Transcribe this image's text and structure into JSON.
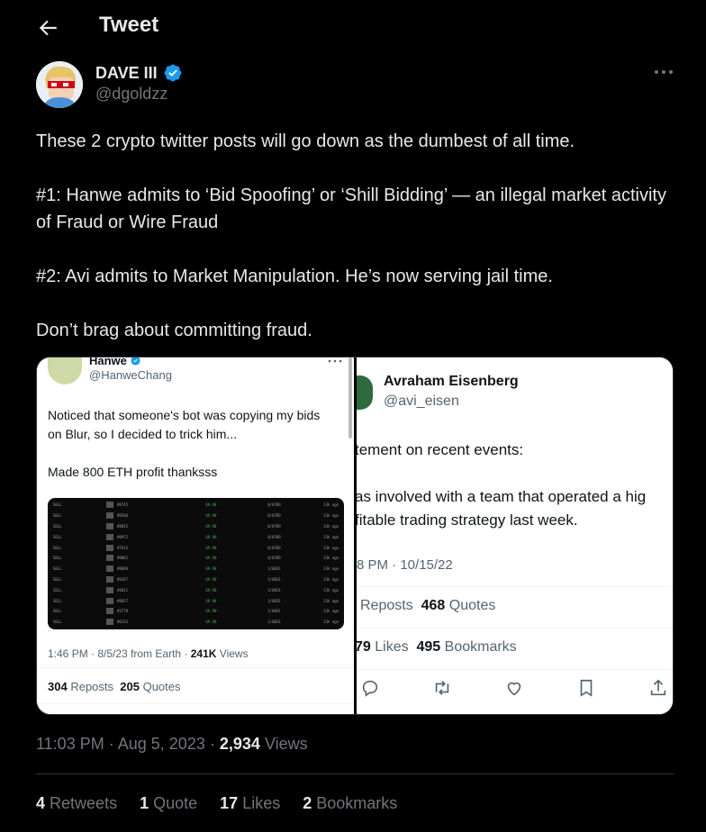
{
  "header": {
    "title": "Tweet"
  },
  "author": {
    "name": "DAVE III",
    "handle": "@dgoldzz"
  },
  "tweet": {
    "paragraphs": [
      "These 2 crypto twitter posts will go down as the dumbest of all time.",
      "#1: Hanwe admits to ‘Bid Spoofing’ or ‘Shill Bidding’ — an illegal market activity of Fraud or Wire Fraud",
      "#2: Avi admits to Market Manipulation. He’s now serving jail time.",
      "Don’t brag about committing fraud."
    ],
    "time": "11:03 PM",
    "date": "Aug 5, 2023",
    "views_count": "2,934",
    "views_label": "Views",
    "separator": "·"
  },
  "stats": {
    "retweets_count": "4",
    "retweets_label": "Retweets",
    "quotes_count": "1",
    "quotes_label": "Quote",
    "likes_count": "17",
    "likes_label": "Likes",
    "bookmarks_count": "2",
    "bookmarks_label": "Bookmarks"
  },
  "embed_left": {
    "name": "Hanwe",
    "handle": "@HanweChang",
    "text1": "Noticed that someone's bot was copying my bids on Blur, so I decided to trick him...",
    "text2": "Made 800 ETH profit thanksss",
    "meta_time": "1:46 PM · 8/5/23 from Earth ·",
    "views_count": "241K",
    "views_label": "Views",
    "reposts_count": "304",
    "reposts_label": "Reposts",
    "quotes_count": "205",
    "quotes_label": "Quotes",
    "table_rows": [
      [
        "SELL",
        "#8745",
        "69.90",
        "0/0789",
        "13h ago"
      ],
      [
        "SELL",
        "#8560",
        "69.90",
        "0/0789",
        "13h ago"
      ],
      [
        "SELL",
        "#8835",
        "69.90",
        "0/0789",
        "13h ago"
      ],
      [
        "SELL",
        "#8972",
        "69.90",
        "0/0789",
        "13h ago"
      ],
      [
        "SELL",
        "#7613",
        "69.90",
        "0/0789",
        "13h ago"
      ],
      [
        "SELL",
        "#8081",
        "69.90",
        "0/0789",
        "13h ago"
      ],
      [
        "SELL",
        "#8096",
        "69.90",
        "1/0831",
        "13h ago"
      ],
      [
        "SELL",
        "#8167",
        "69.90",
        "1/0831",
        "13h ago"
      ],
      [
        "SELL",
        "#4821",
        "69.90",
        "1/0831",
        "13h ago"
      ],
      [
        "SELL",
        "#8027",
        "69.90",
        "1/0831",
        "13h ago"
      ],
      [
        "SELL",
        "#2778",
        "69.90",
        "1/0831",
        "13h ago"
      ],
      [
        "SELL",
        "#8313",
        "69.90",
        "1/0831",
        "13h ago"
      ]
    ]
  },
  "embed_right": {
    "name": "Avraham Eisenberg",
    "handle": "@avi_eisen",
    "line1": "tement on recent events:",
    "line2": "as involved with a team that operated a hig",
    "line3": "fitable trading strategy last week.",
    "date": "8 PM · 10/15/22",
    "reposts_label": "Reposts",
    "quotes_count": "468",
    "quotes_label": "Quotes",
    "likes_count": "79",
    "likes_label": "Likes",
    "bookmarks_count": "495",
    "bookmarks_label": "Bookmarks"
  },
  "colors": {
    "verified": "#1d9bf0",
    "muted": "#71767b",
    "text": "#e7e9ea"
  }
}
